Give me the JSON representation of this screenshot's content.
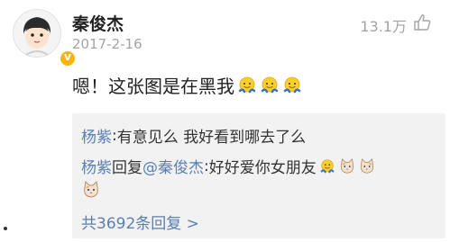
{
  "post": {
    "author": "秦俊杰",
    "date": "2017-2-16",
    "likes": "13.1万",
    "badge": "V",
    "comment_text": "嗯！这张图是在黑我"
  },
  "replies": [
    {
      "user": "杨紫",
      "separator": ": ",
      "text": "有意见么 我好看到哪去了么"
    },
    {
      "user": "杨紫",
      "reply_word": " 回复",
      "mention": "@秦俊杰",
      "separator": ":",
      "text": "好好爱你女朋友"
    }
  ],
  "total_replies": "共3692条回复 >",
  "colors": {
    "link": "#5a7fb0",
    "reply_bg": "#f2f2f2",
    "muted": "#a3a3a3"
  },
  "icons": [
    "avatar",
    "verified-badge-icon",
    "thumbs-up-icon",
    "emoji-icon",
    "cat-emoji-icon"
  ]
}
